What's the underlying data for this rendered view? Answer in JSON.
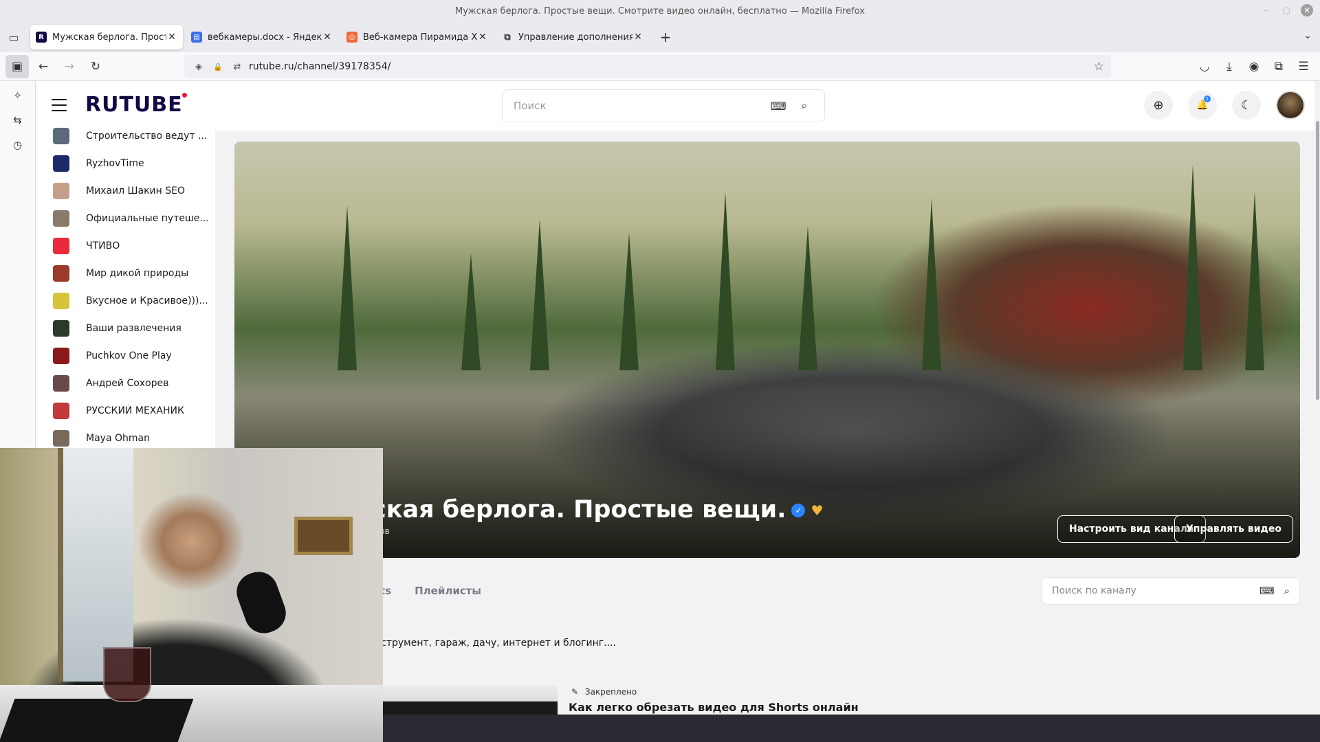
{
  "window": {
    "title": "Мужская берлога. Простые вещи. Смотрите видео онлайн, бесплатно — Mozilla Firefox",
    "minimize": "–",
    "maximize": "▢",
    "close": "✕"
  },
  "tabs": [
    {
      "label": "Мужская берлога. Простые вещи.",
      "favicon": "rutube-icon",
      "fav_color": "#100943",
      "fav_text": "R",
      "active": true
    },
    {
      "label": "вебкамеры.docx - Яндекс Документы",
      "favicon": "docs-icon",
      "fav_color": "#3a6ee8",
      "fav_text": "▤",
      "active": false
    },
    {
      "label": "Веб-камера Пирамида Xeon",
      "favicon": "pyramid-icon",
      "fav_color": "#f26a3a",
      "fav_text": "◎",
      "active": false
    },
    {
      "label": "Управление дополнениями",
      "favicon": "puzzle-icon",
      "fav_color": "#ffffff",
      "fav_text": "⧉",
      "active": false
    }
  ],
  "tab_close": "✕",
  "new_tab": "+",
  "tab_overflow": "⌄",
  "nav": {
    "url": "rutube.ru/channel/39178354/",
    "back": "←",
    "forward": "→",
    "reload": "↻",
    "sidebar": "▣",
    "star": "☆",
    "pocket": "◡",
    "download": "⤓",
    "account": "◉",
    "extensions": "⧉",
    "menu": "☰",
    "shield": "◈",
    "lock": "🔒",
    "perm": "⇄"
  },
  "ff_sidebar": {
    "ai": "✧",
    "sync": "⇆",
    "history": "◷"
  },
  "header": {
    "logo": "RUTUBE",
    "search_placeholder": "Поиск",
    "keyboard": "⌨",
    "search": "⌕",
    "upload": "⊕",
    "notifications": "🔔",
    "notif_count": "1",
    "theme": "☾"
  },
  "channels": [
    {
      "name": "Строительство ведут ...",
      "color": "#5a6a7a"
    },
    {
      "name": "RyzhovTime",
      "color": "#1d2a6a"
    },
    {
      "name": "Михаил Шакин SEO",
      "color": "#c4a08a"
    },
    {
      "name": "Официальные путеше...",
      "color": "#8a7a6a"
    },
    {
      "name": "ЧТИВО",
      "color": "#ea2a3a"
    },
    {
      "name": "Мир дикой природы",
      "color": "#9a3a2a"
    },
    {
      "name": "Вкусное и Красивое)))...",
      "color": "#d8c43a"
    },
    {
      "name": "Ваши развлечения",
      "color": "#2a3a2a"
    },
    {
      "name": "Puchkov One Play",
      "color": "#8a1a1a"
    },
    {
      "name": "Андрей Сохорев",
      "color": "#6a4a4a"
    },
    {
      "name": "РУССКИЙ МЕХАНИК",
      "color": "#c23a3a"
    },
    {
      "name": "Maya Ohman",
      "color": "#7a6a5a"
    }
  ],
  "banner": {
    "title": "ская берлога. Простые вещи.",
    "verified": "✓",
    "heart": "♥",
    "subtitle": "ков",
    "btn_customize": "Настроить вид канала",
    "btn_manage": "Управлять видео"
  },
  "channel_tabs": [
    "ts",
    "Плейлисты"
  ],
  "channel_search_placeholder": "Поиск по каналу",
  "channel_search_keyboard": "⌨",
  "channel_search_icon": "⌕",
  "description": "нструмент, гараж, дачу, интернет и блогинг....",
  "pinned": {
    "label": "Закреплено",
    "pin_icon": "✎",
    "title": "Как легко обрезать видео для Shorts онлайн"
  }
}
